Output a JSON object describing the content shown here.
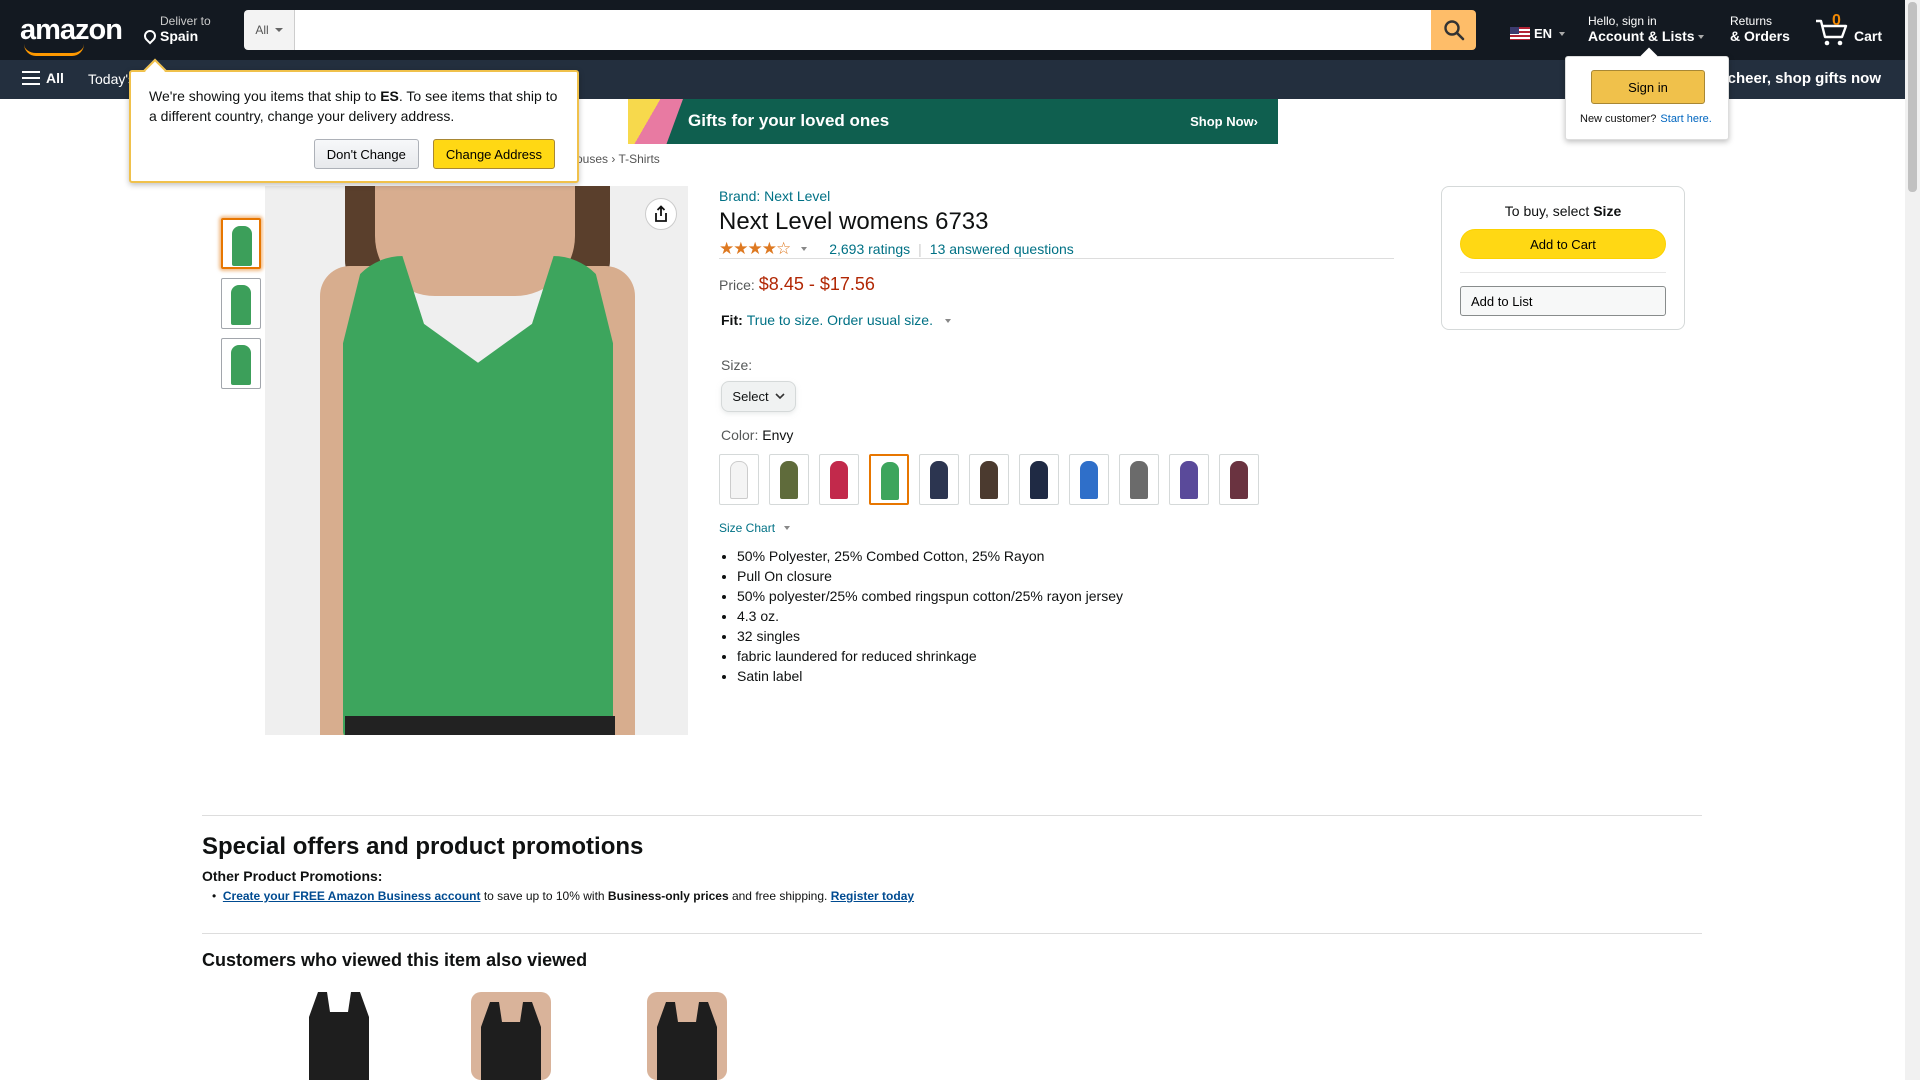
{
  "header": {
    "logo": "amazon",
    "deliver_small": "Deliver to",
    "deliver_big": "Spain",
    "search_category": "All",
    "search_placeholder": "",
    "lang": "EN",
    "account_small": "Hello, sign in",
    "account_big": "Account & Lists",
    "orders_small": "Returns",
    "orders_big": "& Orders",
    "cart_count": "0",
    "cart_label": "Cart"
  },
  "nav": {
    "all": "All",
    "today": "Today's",
    "promo": "Share the cheer, shop gifts now"
  },
  "ship_popup": {
    "text_pre": "We're showing you items that ship to ",
    "country": "ES",
    "text_post": ". To see items that ship to a different country, change your delivery address.",
    "dont_change": "Don't Change",
    "change_address": "Change Address"
  },
  "sign_popup": {
    "sign_in": "Sign in",
    "new_customer": "New customer?",
    "start_here": "Start here."
  },
  "banner": {
    "text": "Gifts for your loved ones",
    "cta": "Shop Now›"
  },
  "breadcrumb": "ouses › T-Shirts",
  "product": {
    "brand": "Brand: Next Level",
    "title": "Next Level womens 6733",
    "stars": "★★★★☆",
    "rating": 4.3,
    "ratings_count": "2,693 ratings",
    "answered": "13 answered questions",
    "price_label": "Price:",
    "price_range": "$8.45 - $17.56",
    "fit_label": "Fit:",
    "fit_text": "True to size. Order usual size.",
    "size_label": "Size:",
    "size_value": "Select",
    "color_label": "Color: ",
    "color_value": "Envy",
    "size_chart": "Size Chart",
    "bullets": [
      "50% Polyester, 25% Combed Cotton, 25% Rayon",
      "Pull On closure",
      "50% polyester/25% combed ringspun cotton/25% rayon jersey",
      "4.3 oz.",
      "32 singles",
      "fabric laundered for reduced shrinkage",
      "Satin label"
    ],
    "swatch_colors": [
      "#f4f4f4",
      "#5f6b3b",
      "#c2294b",
      "#3da55d",
      "#2c3550",
      "#4b3a2f",
      "#1f2a44",
      "#2f6fc9",
      "#6b6b6b",
      "#5a4a9a",
      "#6a3340"
    ]
  },
  "buybox": {
    "hint_pre": "To buy, select ",
    "hint_bold": "Size",
    "add_to_cart": "Add to Cart",
    "add_to_list": "Add to List"
  },
  "offers": {
    "heading": "Special offers and product promotions",
    "other": "Other Product Promotions:",
    "link1": "Create your FREE Amazon Business account",
    "mid1": " to save up to 10% with ",
    "bold1": "Business-only prices",
    "mid2": " and free shipping. ",
    "link2": "Register today"
  },
  "viewed": {
    "heading": "Customers who viewed this item also viewed"
  }
}
